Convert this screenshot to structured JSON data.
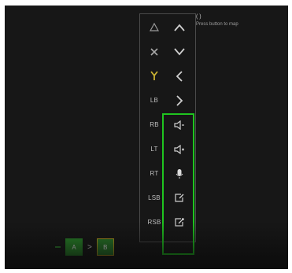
{
  "colors": {
    "background": "#171717",
    "panel_border": "#4a4a4a",
    "highlight": "#1fc41f",
    "text": "#bdbdbd"
  },
  "left_column": [
    {
      "label": "",
      "icon": "triangle-icon"
    },
    {
      "label": "",
      "icon": "x-cross-icon"
    },
    {
      "label": "",
      "icon": "y-fork-icon"
    },
    {
      "label": "LB",
      "icon": ""
    },
    {
      "label": "RB",
      "icon": ""
    },
    {
      "label": "LT",
      "icon": ""
    },
    {
      "label": "RT",
      "icon": ""
    },
    {
      "label": "LSB",
      "icon": ""
    },
    {
      "label": "RSB",
      "icon": ""
    }
  ],
  "right_column": [
    {
      "icon": "chevron-up-icon"
    },
    {
      "icon": "chevron-down-icon"
    },
    {
      "icon": "chevron-left-icon"
    },
    {
      "icon": "chevron-right-icon"
    },
    {
      "icon": "volume-down-icon"
    },
    {
      "icon": "volume-up-icon"
    },
    {
      "icon": "microphone-icon"
    },
    {
      "icon": "edit-box-icon"
    },
    {
      "icon": "edit-box-alt-icon"
    }
  ],
  "corner_hint": {
    "line1": "( )",
    "caption": "Press button to map"
  },
  "bottom_sequence": {
    "key1": "A",
    "separator": ">",
    "key2": "B"
  }
}
